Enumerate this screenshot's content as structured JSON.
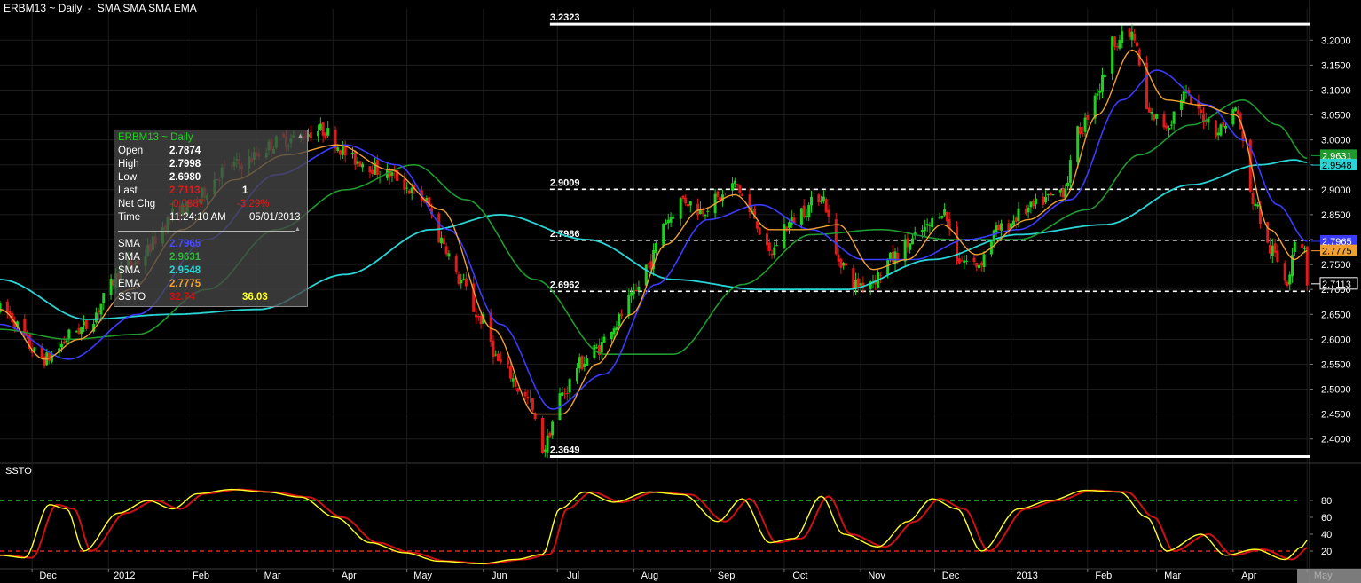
{
  "header": {
    "symbol_title": "ERBM13 ~ Daily",
    "studies": "SMA SMA SMA EMA"
  },
  "lower_pane_label": "SSTO",
  "info_box": {
    "title": "ERBM13 ~ Daily",
    "open_label": "Open",
    "open": "2.7874",
    "high_label": "High",
    "high": "2.7998",
    "low_label": "Low",
    "low": "2.6980",
    "last_label": "Last",
    "last": "2.7113",
    "last_extra": "1",
    "netchg_label": "Net Chg",
    "netchg": "-0.0887",
    "netchg_pct": "-3.29%",
    "time_label": "Time",
    "time": "11:24:10 AM",
    "date": "05/01/2013",
    "sma1_label": "SMA",
    "sma1": "2.7965",
    "sma2_label": "SMA",
    "sma2": "2.9631",
    "sma3_label": "SMA",
    "sma3": "2.9548",
    "ema_label": "EMA",
    "ema": "2.7775",
    "ssto_label": "SSTO",
    "ssto_k": "32.74",
    "ssto_d": "36.03"
  },
  "colors": {
    "background": "#000000",
    "up_candle": "#1fd11f",
    "down_candle": "#e31a1a",
    "sma1": "#3b3bff",
    "sma2": "#1f9a2e",
    "sma3": "#2ad4d4",
    "ema": "#f0a030",
    "ssto_k": "#ffff22",
    "ssto_d": "#cc1111",
    "ob_line": "#22cc22",
    "os_line": "#dd2222"
  },
  "chart_data": {
    "type": "candlestick",
    "price_axis": {
      "ylim": [
        2.355,
        3.245
      ],
      "ticks": [
        "3.2000",
        "3.1500",
        "3.1000",
        "3.0500",
        "3.0000",
        "2.9500",
        "2.9000",
        "2.8500",
        "2.8000",
        "2.7500",
        "2.7000",
        "2.6500",
        "2.6000",
        "2.5500",
        "2.5000",
        "2.4500",
        "2.4000"
      ]
    },
    "time_axis": {
      "labels": [
        "Dec",
        "2012",
        "Feb",
        "Mar",
        "Apr",
        "May",
        "Jun",
        "Jul",
        "Aug",
        "Sep",
        "Oct",
        "Nov",
        "Dec",
        "2013",
        "Feb",
        "Mar",
        "Apr",
        "May"
      ],
      "range": [
        "2011-11-18",
        "2013-05-02"
      ]
    },
    "level_lines": [
      {
        "value": 3.2323,
        "label": "3.2323",
        "style": "solid"
      },
      {
        "value": 2.9009,
        "label": "2.9009",
        "style": "dashed"
      },
      {
        "value": 2.7986,
        "label": "2.7986",
        "style": "dashed"
      },
      {
        "value": 2.6962,
        "label": "2.6962",
        "style": "dashed"
      },
      {
        "value": 2.3649,
        "label": "2.3649",
        "style": "solid"
      }
    ],
    "price_tags": [
      {
        "value": 2.9631,
        "label": "2.9631",
        "series": "sma2"
      },
      {
        "value": 2.9548,
        "label": "2.9548",
        "series": "sma3"
      },
      {
        "value": 2.7965,
        "label": "2.7965",
        "series": "sma1"
      },
      {
        "value": 2.7775,
        "label": "2.7775",
        "series": "ema"
      },
      {
        "value": 2.7113,
        "label": "2.7113",
        "series": "last"
      }
    ],
    "price_anchors": [
      [
        "2011-11-18",
        2.66
      ],
      [
        "2011-12-06",
        2.56
      ],
      [
        "2011-12-20",
        2.62
      ],
      [
        "2012-01-10",
        2.75
      ],
      [
        "2012-01-31",
        2.86
      ],
      [
        "2012-02-21",
        2.95
      ],
      [
        "2012-03-13",
        3.0
      ],
      [
        "2012-03-27",
        3.02
      ],
      [
        "2012-04-10",
        2.96
      ],
      [
        "2012-04-24",
        2.93
      ],
      [
        "2012-05-08",
        2.88
      ],
      [
        "2012-05-15",
        2.8
      ],
      [
        "2012-05-22",
        2.72
      ],
      [
        "2012-05-31",
        2.64
      ],
      [
        "2012-06-08",
        2.55
      ],
      [
        "2012-06-19",
        2.48
      ],
      [
        "2012-06-25",
        2.38
      ],
      [
        "2012-07-03",
        2.49
      ],
      [
        "2012-07-10",
        2.55
      ],
      [
        "2012-07-17",
        2.58
      ],
      [
        "2012-07-24",
        2.63
      ],
      [
        "2012-07-31",
        2.68
      ],
      [
        "2012-08-07",
        2.75
      ],
      [
        "2012-08-14",
        2.84
      ],
      [
        "2012-08-21",
        2.88
      ],
      [
        "2012-08-28",
        2.86
      ],
      [
        "2012-09-04",
        2.88
      ],
      [
        "2012-09-11",
        2.91
      ],
      [
        "2012-09-18",
        2.85
      ],
      [
        "2012-09-25",
        2.77
      ],
      [
        "2012-10-02",
        2.83
      ],
      [
        "2012-10-09",
        2.86
      ],
      [
        "2012-10-16",
        2.89
      ],
      [
        "2012-10-23",
        2.76
      ],
      [
        "2012-10-30",
        2.71
      ],
      [
        "2012-11-06",
        2.72
      ],
      [
        "2012-11-13",
        2.76
      ],
      [
        "2012-11-20",
        2.79
      ],
      [
        "2012-11-27",
        2.82
      ],
      [
        "2012-12-04",
        2.86
      ],
      [
        "2012-12-11",
        2.76
      ],
      [
        "2012-12-18",
        2.75
      ],
      [
        "2012-12-27",
        2.82
      ],
      [
        "2013-01-08",
        2.86
      ],
      [
        "2013-01-15",
        2.88
      ],
      [
        "2013-01-22",
        2.9
      ],
      [
        "2013-01-29",
        3.02
      ],
      [
        "2013-02-05",
        3.1
      ],
      [
        "2013-02-12",
        3.2
      ],
      [
        "2013-02-19",
        3.21
      ],
      [
        "2013-02-26",
        3.05
      ],
      [
        "2013-03-05",
        3.03
      ],
      [
        "2013-03-12",
        3.09
      ],
      [
        "2013-03-19",
        3.05
      ],
      [
        "2013-03-26",
        3.02
      ],
      [
        "2013-04-02",
        3.06
      ],
      [
        "2013-04-09",
        2.88
      ],
      [
        "2013-04-16",
        2.78
      ],
      [
        "2013-04-23",
        2.72
      ],
      [
        "2013-04-26",
        2.8
      ],
      [
        "2013-04-30",
        2.79
      ],
      [
        "2013-05-01",
        2.71
      ]
    ],
    "sma1_anchors": [
      [
        "2011-11-18",
        2.63
      ],
      [
        "2011-12-16",
        2.56
      ],
      [
        "2012-01-13",
        2.65
      ],
      [
        "2012-02-10",
        2.8
      ],
      [
        "2012-03-09",
        2.93
      ],
      [
        "2012-04-06",
        2.99
      ],
      [
        "2012-04-27",
        2.95
      ],
      [
        "2012-05-18",
        2.82
      ],
      [
        "2012-06-08",
        2.63
      ],
      [
        "2012-06-29",
        2.46
      ],
      [
        "2012-07-20",
        2.53
      ],
      [
        "2012-08-10",
        2.71
      ],
      [
        "2012-08-31",
        2.84
      ],
      [
        "2012-09-21",
        2.87
      ],
      [
        "2012-10-12",
        2.82
      ],
      [
        "2012-11-02",
        2.76
      ],
      [
        "2012-11-23",
        2.76
      ],
      [
        "2012-12-14",
        2.8
      ],
      [
        "2013-01-04",
        2.82
      ],
      [
        "2013-01-25",
        2.88
      ],
      [
        "2013-02-15",
        3.08
      ],
      [
        "2013-03-01",
        3.14
      ],
      [
        "2013-03-22",
        3.07
      ],
      [
        "2013-04-05",
        3.0
      ],
      [
        "2013-04-19",
        2.87
      ],
      [
        "2013-05-01",
        2.7965
      ]
    ],
    "sma2_anchors": [
      [
        "2011-11-18",
        2.62
      ],
      [
        "2011-12-16",
        2.6
      ],
      [
        "2012-01-13",
        2.61
      ],
      [
        "2012-02-10",
        2.7
      ],
      [
        "2012-03-09",
        2.82
      ],
      [
        "2012-04-06",
        2.9
      ],
      [
        "2012-05-04",
        2.95
      ],
      [
        "2012-05-25",
        2.88
      ],
      [
        "2012-06-22",
        2.72
      ],
      [
        "2012-07-20",
        2.57
      ],
      [
        "2012-08-17",
        2.57
      ],
      [
        "2012-09-14",
        2.71
      ],
      [
        "2012-10-12",
        2.81
      ],
      [
        "2012-11-09",
        2.82
      ],
      [
        "2012-12-07",
        2.8
      ],
      [
        "2013-01-04",
        2.8
      ],
      [
        "2013-02-01",
        2.86
      ],
      [
        "2013-02-22",
        2.97
      ],
      [
        "2013-03-15",
        3.03
      ],
      [
        "2013-04-05",
        3.08
      ],
      [
        "2013-04-19",
        3.03
      ],
      [
        "2013-05-01",
        2.9631
      ]
    ],
    "sma3_anchors": [
      [
        "2011-11-18",
        2.72
      ],
      [
        "2011-12-23",
        2.64
      ],
      [
        "2012-01-27",
        2.65
      ],
      [
        "2012-03-02",
        2.66
      ],
      [
        "2012-04-06",
        2.73
      ],
      [
        "2012-05-11",
        2.82
      ],
      [
        "2012-06-08",
        2.85
      ],
      [
        "2012-07-13",
        2.8
      ],
      [
        "2012-08-17",
        2.72
      ],
      [
        "2012-09-21",
        2.7
      ],
      [
        "2012-10-26",
        2.7
      ],
      [
        "2012-11-30",
        2.76
      ],
      [
        "2013-01-04",
        2.81
      ],
      [
        "2013-02-08",
        2.83
      ],
      [
        "2013-03-15",
        2.91
      ],
      [
        "2013-04-12",
        2.95
      ],
      [
        "2013-04-26",
        2.96
      ],
      [
        "2013-05-01",
        2.9548
      ]
    ],
    "ema_anchors": [
      [
        "2011-11-18",
        2.66
      ],
      [
        "2011-12-06",
        2.56
      ],
      [
        "2011-12-20",
        2.6
      ],
      [
        "2012-01-10",
        2.7
      ],
      [
        "2012-01-31",
        2.82
      ],
      [
        "2012-02-21",
        2.92
      ],
      [
        "2012-03-13",
        2.97
      ],
      [
        "2012-04-03",
        2.99
      ],
      [
        "2012-04-24",
        2.94
      ],
      [
        "2012-05-15",
        2.86
      ],
      [
        "2012-06-05",
        2.62
      ],
      [
        "2012-06-22",
        2.45
      ],
      [
        "2012-07-03",
        2.45
      ],
      [
        "2012-07-17",
        2.55
      ],
      [
        "2012-07-31",
        2.65
      ],
      [
        "2012-08-14",
        2.79
      ],
      [
        "2012-08-28",
        2.86
      ],
      [
        "2012-09-11",
        2.89
      ],
      [
        "2012-09-25",
        2.82
      ],
      [
        "2012-10-09",
        2.82
      ],
      [
        "2012-10-23",
        2.83
      ],
      [
        "2012-11-06",
        2.74
      ],
      [
        "2012-11-20",
        2.76
      ],
      [
        "2012-12-04",
        2.83
      ],
      [
        "2012-12-18",
        2.77
      ],
      [
        "2013-01-08",
        2.84
      ],
      [
        "2013-01-22",
        2.88
      ],
      [
        "2013-02-05",
        3.05
      ],
      [
        "2013-02-19",
        3.18
      ],
      [
        "2013-03-05",
        3.08
      ],
      [
        "2013-03-19",
        3.07
      ],
      [
        "2013-04-02",
        3.05
      ],
      [
        "2013-04-16",
        2.82
      ],
      [
        "2013-04-26",
        2.76
      ],
      [
        "2013-05-01",
        2.7775
      ]
    ],
    "ssto": {
      "ylim": [
        0,
        100
      ],
      "ticks": [
        "80",
        "60",
        "40",
        "20"
      ],
      "overbought": 80,
      "oversold": 20,
      "k_anchors": [
        [
          "2011-11-18",
          15
        ],
        [
          "2011-11-28",
          12
        ],
        [
          "2011-12-08",
          75
        ],
        [
          "2011-12-15",
          70
        ],
        [
          "2011-12-22",
          20
        ],
        [
          "2012-01-05",
          65
        ],
        [
          "2012-01-17",
          80
        ],
        [
          "2012-01-27",
          70
        ],
        [
          "2012-02-06",
          88
        ],
        [
          "2012-02-20",
          93
        ],
        [
          "2012-03-05",
          90
        ],
        [
          "2012-03-19",
          84
        ],
        [
          "2012-04-02",
          60
        ],
        [
          "2012-04-16",
          30
        ],
        [
          "2012-04-30",
          18
        ],
        [
          "2012-05-14",
          8
        ],
        [
          "2012-05-31",
          5
        ],
        [
          "2012-06-14",
          10
        ],
        [
          "2012-06-25",
          16
        ],
        [
          "2012-07-02",
          70
        ],
        [
          "2012-07-12",
          90
        ],
        [
          "2012-07-24",
          78
        ],
        [
          "2012-08-07",
          90
        ],
        [
          "2012-08-21",
          87
        ],
        [
          "2012-09-04",
          55
        ],
        [
          "2012-09-14",
          82
        ],
        [
          "2012-09-25",
          30
        ],
        [
          "2012-10-05",
          35
        ],
        [
          "2012-10-16",
          85
        ],
        [
          "2012-10-25",
          40
        ],
        [
          "2012-11-08",
          25
        ],
        [
          "2012-11-20",
          55
        ],
        [
          "2012-11-30",
          82
        ],
        [
          "2012-12-10",
          70
        ],
        [
          "2012-12-20",
          20
        ],
        [
          "2013-01-04",
          70
        ],
        [
          "2013-01-17",
          80
        ],
        [
          "2013-01-31",
          92
        ],
        [
          "2013-02-14",
          90
        ],
        [
          "2013-02-25",
          60
        ],
        [
          "2013-03-05",
          20
        ],
        [
          "2013-03-19",
          40
        ],
        [
          "2013-03-29",
          15
        ],
        [
          "2013-04-10",
          22
        ],
        [
          "2013-04-22",
          10
        ],
        [
          "2013-04-29",
          25
        ],
        [
          "2013-05-01",
          33
        ]
      ]
    }
  }
}
